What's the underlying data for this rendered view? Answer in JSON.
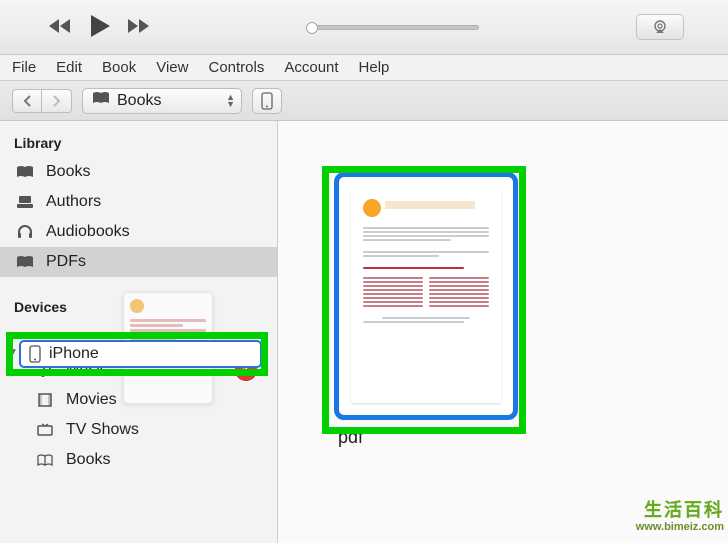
{
  "menubar": [
    "File",
    "Edit",
    "Book",
    "View",
    "Controls",
    "Account",
    "Help"
  ],
  "subtool": {
    "dropdown_label": "Books"
  },
  "sidebar": {
    "section_library": "Library",
    "library_items": [
      {
        "label": "Books",
        "icon": "book"
      },
      {
        "label": "Authors",
        "icon": "typewriter"
      },
      {
        "label": "Audiobooks",
        "icon": "headphones"
      },
      {
        "label": "PDFs",
        "icon": "book",
        "selected": true
      }
    ],
    "section_devices": "Devices",
    "device_selected": "iPhone",
    "device_items": [
      {
        "label": "Music",
        "icon": "music",
        "badge": "1"
      },
      {
        "label": "Movies",
        "icon": "film"
      },
      {
        "label": "TV Shows",
        "icon": "tv"
      },
      {
        "label": "Books",
        "icon": "book-open"
      }
    ]
  },
  "content": {
    "item_label": "pdf"
  },
  "watermark": {
    "cn": "生活百科",
    "url": "www.bimeiz.com"
  }
}
